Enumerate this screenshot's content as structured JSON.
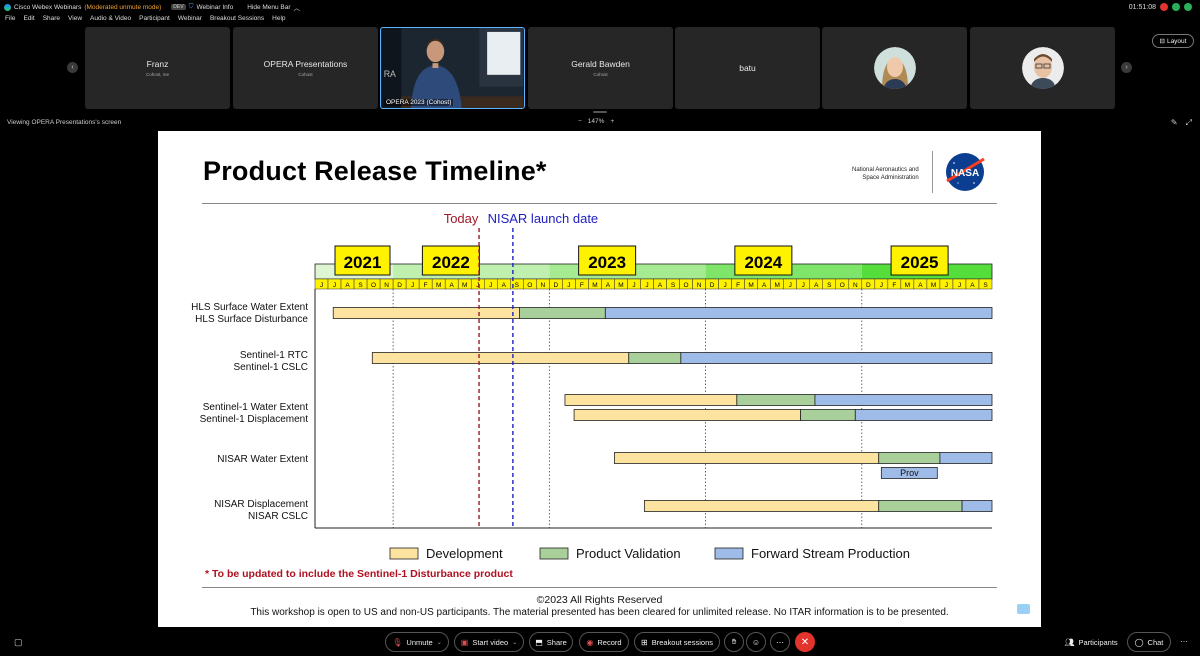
{
  "titlebar": {
    "app_name": "Cisco Webex Webinars",
    "mode": "(Moderated unmute mode)",
    "badge": "DEV",
    "webinar_info": "Webinar Info",
    "hide_menu_bar": "Hide Menu Bar",
    "clock": "01:51:08"
  },
  "menu": [
    "File",
    "Edit",
    "Share",
    "View",
    "Audio & Video",
    "Participant",
    "Webinar",
    "Breakout Sessions",
    "Help"
  ],
  "participants": [
    {
      "name": "Franz",
      "role": "Cohost, me"
    },
    {
      "name": "OPERA Presentations",
      "role": "Cohost"
    },
    {
      "name": "OPERA 2023 (Cohost)",
      "role": ""
    },
    {
      "name": "Gerald Bawden",
      "role": "Cohost"
    },
    {
      "name": "batu",
      "role": ""
    }
  ],
  "layout_label": "Layout",
  "viewing_label": "Viewing OPERA Presentations's screen",
  "zoom": {
    "minus": "−",
    "value": "147%",
    "plus": "+"
  },
  "slide": {
    "title": "Product Release Timeline*",
    "agency_line1": "National Aeronautics and",
    "agency_line2": "Space Administration",
    "nasa_logo_text": "NASA",
    "footnote": "* To be updated to include the Sentinel-1 Disturbance product",
    "copyright": "©2023 All Rights Reserved",
    "disclaimer": "This workshop is open to US and non-US participants. The material presented has been cleared for unlimited release. No ITAR information is to be presented."
  },
  "chart_data": {
    "type": "gantt",
    "markers": [
      {
        "label": "Today",
        "month_index": 12,
        "color": "#a01828"
      },
      {
        "label": "NISAR launch date",
        "month_index": 15,
        "color": "#2020c0"
      }
    ],
    "years": [
      {
        "label": "2021",
        "start_index": 0
      },
      {
        "label": "2022",
        "start_index": 6
      },
      {
        "label": "2023",
        "start_index": 18
      },
      {
        "label": "2024",
        "start_index": 30
      },
      {
        "label": "2025",
        "start_index": 42
      }
    ],
    "months": [
      "J",
      "J",
      "A",
      "S",
      "O",
      "N",
      "D",
      "J",
      "F",
      "M",
      "A",
      "M",
      "J",
      "J",
      "A",
      "S",
      "O",
      "N",
      "D",
      "J",
      "F",
      "M",
      "A",
      "M",
      "J",
      "J",
      "A",
      "S",
      "O",
      "N",
      "D",
      "J",
      "F",
      "M",
      "A",
      "M",
      "J",
      "J",
      "A",
      "S",
      "O",
      "N",
      "D",
      "J",
      "F",
      "M",
      "A",
      "M",
      "J",
      "J",
      "A",
      "S"
    ],
    "phases": [
      {
        "name": "Development",
        "color": "#fde3a0"
      },
      {
        "name": "Product Validation",
        "color": "#a9cf9a"
      },
      {
        "name": "Forward Stream Production",
        "color": "#9fbbe8"
      }
    ],
    "rows": [
      {
        "labels": [
          "HLS Surface Water Extent",
          "HLS Surface Disturbance"
        ],
        "bars": [
          [
            {
              "phase": 0,
              "start": 1.4,
              "end": 15.7
            },
            {
              "phase": 1,
              "start": 15.7,
              "end": 22.3
            },
            {
              "phase": 2,
              "start": 22.3,
              "end": 52
            }
          ]
        ]
      },
      {
        "labels": [
          "Sentinel-1 RTC",
          "Sentinel-1 CSLC"
        ],
        "bars": [
          [
            {
              "phase": 0,
              "start": 4.4,
              "end": 24.1
            },
            {
              "phase": 1,
              "start": 24.1,
              "end": 28.1
            },
            {
              "phase": 2,
              "start": 28.1,
              "end": 52
            }
          ]
        ]
      },
      {
        "labels": [
          "Sentinel-1 Water Extent",
          "Sentinel-1 Displacement"
        ],
        "bars": [
          [
            {
              "phase": 0,
              "start": 19.2,
              "end": 32.4
            },
            {
              "phase": 1,
              "start": 32.4,
              "end": 38.4
            },
            {
              "phase": 2,
              "start": 38.4,
              "end": 52
            }
          ],
          [
            {
              "phase": 0,
              "start": 19.9,
              "end": 37.3
            },
            {
              "phase": 1,
              "start": 37.3,
              "end": 41.5
            },
            {
              "phase": 2,
              "start": 41.5,
              "end": 52
            }
          ]
        ]
      },
      {
        "labels": [
          "NISAR Water Extent"
        ],
        "bars": [
          [
            {
              "phase": 0,
              "start": 23,
              "end": 43.3
            },
            {
              "phase": 1,
              "start": 43.3,
              "end": 48
            },
            {
              "phase": 2,
              "start": 48,
              "end": 52
            }
          ],
          [
            {
              "phase": 2,
              "start": 43.5,
              "end": 47.8,
              "label": "Prov"
            }
          ]
        ]
      },
      {
        "labels": [
          "NISAR Displacement",
          "NISAR CSLC"
        ],
        "bars": [
          [
            {
              "phase": 0,
              "start": 25.3,
              "end": 43.3
            },
            {
              "phase": 1,
              "start": 43.3,
              "end": 49.7
            },
            {
              "phase": 2,
              "start": 49.7,
              "end": 52
            }
          ]
        ]
      }
    ]
  },
  "controls": {
    "unmute": "Unmute",
    "start_video": "Start video",
    "share": "Share",
    "record": "Record",
    "breakout": "Breakout sessions",
    "participants": "Participants",
    "chat": "Chat"
  }
}
